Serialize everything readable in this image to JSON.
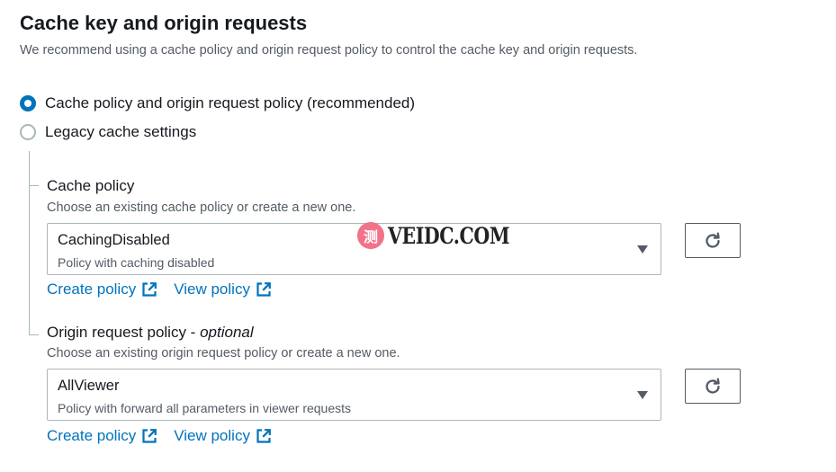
{
  "section": {
    "title": "Cache key and origin requests",
    "description": "We recommend using a cache policy and origin request policy to control the cache key and origin requests."
  },
  "options": [
    {
      "label": "Cache policy and origin request policy (recommended)",
      "selected": true
    },
    {
      "label": "Legacy cache settings",
      "selected": false
    }
  ],
  "cache_policy": {
    "label": "Cache policy",
    "description": "Choose an existing cache policy or create a new one.",
    "selected_value": "CachingDisabled",
    "selected_description": "Policy with caching disabled",
    "create_link": "Create policy",
    "view_link": "View policy"
  },
  "origin_request_policy": {
    "label": "Origin request policy - ",
    "label_suffix": "optional",
    "description": "Choose an existing origin request policy or create a new one.",
    "selected_value": "AllViewer",
    "selected_description": "Policy with forward all parameters in viewer requests",
    "create_link": "Create policy",
    "view_link": "View policy"
  },
  "watermark": {
    "seal": "测",
    "text": "VEIDC.COM"
  },
  "icons": {
    "refresh": "refresh-icon",
    "external_link": "external-link-icon",
    "dropdown": "caret-down-icon"
  },
  "colors": {
    "link": "#0073bb",
    "radio_selected": "#0073bb",
    "text_primary": "#16191f",
    "text_secondary": "#545b64",
    "border": "#aab7b8"
  }
}
